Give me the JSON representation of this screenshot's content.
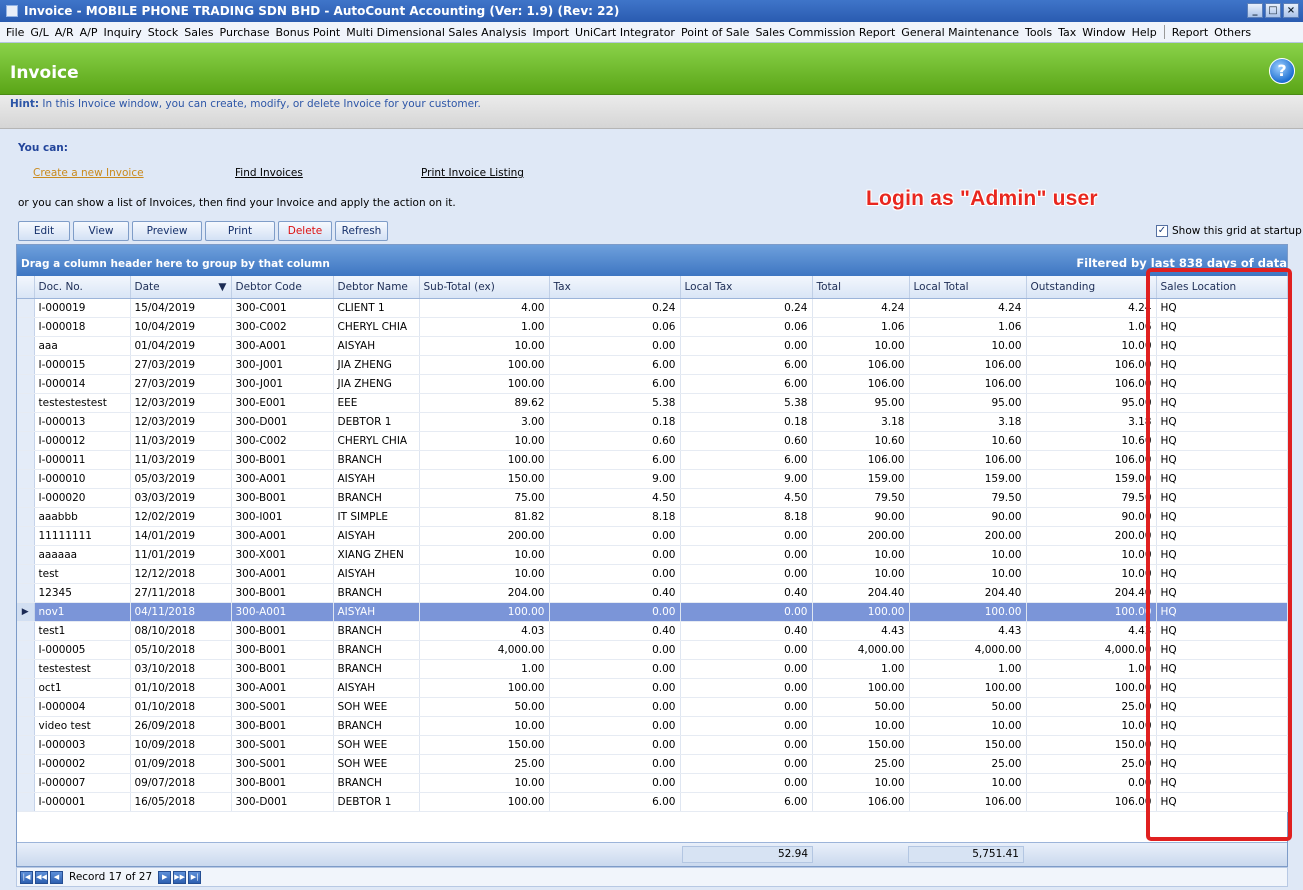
{
  "window": {
    "title": "Invoice - MOBILE PHONE TRADING SDN BHD - AutoCount Accounting (Ver: 1.9) (Rev: 22)",
    "buttons": [
      "_",
      "□",
      "×"
    ]
  },
  "menu": [
    "File",
    "G/L",
    "A/R",
    "A/P",
    "Inquiry",
    "Stock",
    "Sales",
    "Purchase",
    "Bonus Point",
    "Multi Dimensional Sales Analysis",
    "Import",
    "UniCart Integrator",
    "Point of Sale",
    "Sales Commission Report",
    "General Maintenance",
    "Tools",
    "Tax",
    "Window",
    "Help",
    "Report",
    "Others"
  ],
  "header": {
    "title": "Invoice",
    "help_glyph": "?"
  },
  "hint": {
    "label": "Hint:",
    "text": " In this Invoice window, you can create, modify, or delete Invoice for your customer."
  },
  "you_can": "You can:",
  "actions": {
    "create": "Create a new Invoice",
    "find": "Find Invoices",
    "print": "Print Invoice Listing"
  },
  "or_text": "or you can show a list of Invoices, then find your Invoice and apply the action on it.",
  "annotation": "Login as \"Admin\" user",
  "toolbar": {
    "edit": "Edit",
    "view": "View",
    "preview": "Preview",
    "print": "Print",
    "delete": "Delete",
    "refresh": "Refresh"
  },
  "show_grid": {
    "label": "Show this grid at startup",
    "checked": true
  },
  "grid": {
    "group_hint": "Drag a column header here to group by that column",
    "filter_text": "Filtered by last 838 days of data",
    "columns": [
      "Doc. No.",
      "Date",
      "Debtor Code",
      "Debtor Name",
      "Sub-Total (ex)",
      "Tax",
      "Local Tax",
      "Total",
      "Local Total",
      "Outstanding",
      "Sales Location"
    ],
    "sort_indicator": "▼",
    "selected_row": 16,
    "rows": [
      [
        "I-000019",
        "15/04/2019",
        "300-C001",
        "CLIENT 1",
        "4.00",
        "0.24",
        "0.24",
        "4.24",
        "4.24",
        "4.24",
        "HQ"
      ],
      [
        "I-000018",
        "10/04/2019",
        "300-C002",
        "CHERYL CHIA",
        "1.00",
        "0.06",
        "0.06",
        "1.06",
        "1.06",
        "1.06",
        "HQ"
      ],
      [
        "aaa",
        "01/04/2019",
        "300-A001",
        "AISYAH",
        "10.00",
        "0.00",
        "0.00",
        "10.00",
        "10.00",
        "10.00",
        "HQ"
      ],
      [
        "I-000015",
        "27/03/2019",
        "300-J001",
        "JIA ZHENG",
        "100.00",
        "6.00",
        "6.00",
        "106.00",
        "106.00",
        "106.00",
        "HQ"
      ],
      [
        "I-000014",
        "27/03/2019",
        "300-J001",
        "JIA ZHENG",
        "100.00",
        "6.00",
        "6.00",
        "106.00",
        "106.00",
        "106.00",
        "HQ"
      ],
      [
        "testestestest",
        "12/03/2019",
        "300-E001",
        "EEE",
        "89.62",
        "5.38",
        "5.38",
        "95.00",
        "95.00",
        "95.00",
        "HQ"
      ],
      [
        "I-000013",
        "12/03/2019",
        "300-D001",
        "DEBTOR 1",
        "3.00",
        "0.18",
        "0.18",
        "3.18",
        "3.18",
        "3.18",
        "HQ"
      ],
      [
        "I-000012",
        "11/03/2019",
        "300-C002",
        "CHERYL CHIA",
        "10.00",
        "0.60",
        "0.60",
        "10.60",
        "10.60",
        "10.60",
        "HQ"
      ],
      [
        "I-000011",
        "11/03/2019",
        "300-B001",
        "BRANCH",
        "100.00",
        "6.00",
        "6.00",
        "106.00",
        "106.00",
        "106.00",
        "HQ"
      ],
      [
        "I-000010",
        "05/03/2019",
        "300-A001",
        "AISYAH",
        "150.00",
        "9.00",
        "9.00",
        "159.00",
        "159.00",
        "159.00",
        "HQ"
      ],
      [
        "I-000020",
        "03/03/2019",
        "300-B001",
        "BRANCH",
        "75.00",
        "4.50",
        "4.50",
        "79.50",
        "79.50",
        "79.50",
        "HQ"
      ],
      [
        "aaabbb",
        "12/02/2019",
        "300-I001",
        "IT SIMPLE",
        "81.82",
        "8.18",
        "8.18",
        "90.00",
        "90.00",
        "90.00",
        "HQ"
      ],
      [
        "11111111",
        "14/01/2019",
        "300-A001",
        "AISYAH",
        "200.00",
        "0.00",
        "0.00",
        "200.00",
        "200.00",
        "200.00",
        "HQ"
      ],
      [
        "aaaaaa",
        "11/01/2019",
        "300-X001",
        "XIANG ZHEN",
        "10.00",
        "0.00",
        "0.00",
        "10.00",
        "10.00",
        "10.00",
        "HQ"
      ],
      [
        "test",
        "12/12/2018",
        "300-A001",
        "AISYAH",
        "10.00",
        "0.00",
        "0.00",
        "10.00",
        "10.00",
        "10.00",
        "HQ"
      ],
      [
        "12345",
        "27/11/2018",
        "300-B001",
        "BRANCH",
        "204.00",
        "0.40",
        "0.40",
        "204.40",
        "204.40",
        "204.40",
        "HQ"
      ],
      [
        "nov1",
        "04/11/2018",
        "300-A001",
        "AISYAH",
        "100.00",
        "0.00",
        "0.00",
        "100.00",
        "100.00",
        "100.00",
        "HQ"
      ],
      [
        "test1",
        "08/10/2018",
        "300-B001",
        "BRANCH",
        "4.03",
        "0.40",
        "0.40",
        "4.43",
        "4.43",
        "4.43",
        "HQ"
      ],
      [
        "I-000005",
        "05/10/2018",
        "300-B001",
        "BRANCH",
        "4,000.00",
        "0.00",
        "0.00",
        "4,000.00",
        "4,000.00",
        "4,000.00",
        "HQ"
      ],
      [
        "testestest",
        "03/10/2018",
        "300-B001",
        "BRANCH",
        "1.00",
        "0.00",
        "0.00",
        "1.00",
        "1.00",
        "1.00",
        "HQ"
      ],
      [
        "oct1",
        "01/10/2018",
        "300-A001",
        "AISYAH",
        "100.00",
        "0.00",
        "0.00",
        "100.00",
        "100.00",
        "100.00",
        "HQ"
      ],
      [
        "I-000004",
        "01/10/2018",
        "300-S001",
        "SOH WEE",
        "50.00",
        "0.00",
        "0.00",
        "50.00",
        "50.00",
        "25.00",
        "HQ"
      ],
      [
        "video test",
        "26/09/2018",
        "300-B001",
        "BRANCH",
        "10.00",
        "0.00",
        "0.00",
        "10.00",
        "10.00",
        "10.00",
        "HQ"
      ],
      [
        "I-000003",
        "10/09/2018",
        "300-S001",
        "SOH WEE",
        "150.00",
        "0.00",
        "0.00",
        "150.00",
        "150.00",
        "150.00",
        "HQ"
      ],
      [
        "I-000002",
        "01/09/2018",
        "300-S001",
        "SOH WEE",
        "25.00",
        "0.00",
        "0.00",
        "25.00",
        "25.00",
        "25.00",
        "HQ"
      ],
      [
        "I-000007",
        "09/07/2018",
        "300-B001",
        "BRANCH",
        "10.00",
        "0.00",
        "0.00",
        "10.00",
        "10.00",
        "0.00",
        "HQ"
      ],
      [
        "I-000001",
        "16/05/2018",
        "300-D001",
        "DEBTOR 1",
        "100.00",
        "6.00",
        "6.00",
        "106.00",
        "106.00",
        "106.00",
        "HQ"
      ]
    ],
    "totals": {
      "local_tax": "52.94",
      "local_total": "5,751.41"
    }
  },
  "navigator": {
    "record_text": "Record 17 of 27"
  },
  "colors": {
    "highlight": "#e02020",
    "selected_row": "#7b95d8",
    "header_green": "#6bbf2a"
  }
}
